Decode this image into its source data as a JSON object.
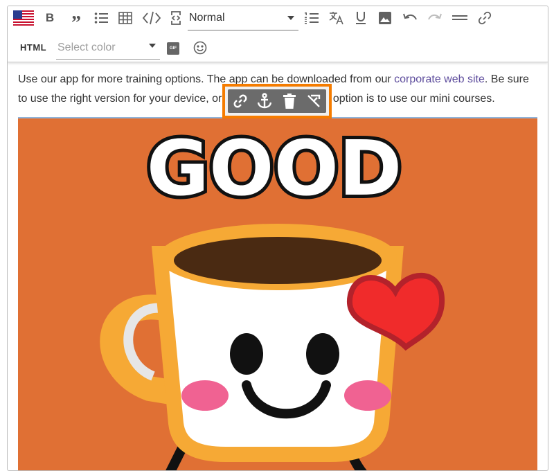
{
  "toolbar": {
    "bold_label": "B",
    "quote_label": "”",
    "format_select": {
      "value": "Normal"
    },
    "html_label": "HTML",
    "color_select": {
      "placeholder": "Select color"
    },
    "gif_label": "GIF"
  },
  "content": {
    "paragraph_part1": "Use our app for more training options. The app can be downloaded from our ",
    "link_text": "corporate web site",
    "paragraph_part2": ". Be sure to use the right version for your device, or it won't work. Another option is to use our mini courses."
  },
  "image": {
    "caption_word": "GOOD"
  },
  "colors": {
    "accent_orange": "#f57c00",
    "image_background": "#e07034",
    "link": "#5e4d9d"
  },
  "icons": {
    "toolbar": [
      "us-flag-icon",
      "bold-icon",
      "quote-icon",
      "bulleted-list-icon",
      "table-icon",
      "code-icon",
      "code-block-icon",
      "numbered-list-icon",
      "translate-icon",
      "underline-icon",
      "image-icon",
      "undo-icon",
      "redo-icon",
      "horizontal-rule-icon",
      "link-icon",
      "emoji-icon"
    ],
    "popup": [
      "edit-link-icon",
      "anchor-icon",
      "delete-icon",
      "remove-link-icon"
    ]
  }
}
